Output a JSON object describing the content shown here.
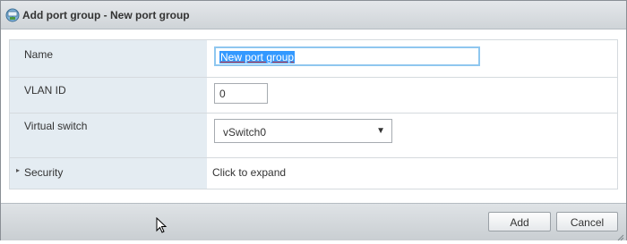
{
  "dialog": {
    "title": "Add port group - New port group",
    "title_icon": "port-group-network-icon"
  },
  "form": {
    "name": {
      "label": "Name",
      "value": "New port group"
    },
    "vlan": {
      "label": "VLAN ID",
      "value": "0"
    },
    "vswitch": {
      "label": "Virtual switch",
      "selected": "vSwitch0",
      "arrow": "▼"
    },
    "security": {
      "label": "Security",
      "expand_text": "Click to expand",
      "expander": "▸"
    }
  },
  "buttons": {
    "add": "Add",
    "cancel": "Cancel"
  },
  "colors": {
    "label_column_bg": "#e4ecf2",
    "focus_border": "#8fc7ef",
    "selection_bg": "#3399ff"
  }
}
